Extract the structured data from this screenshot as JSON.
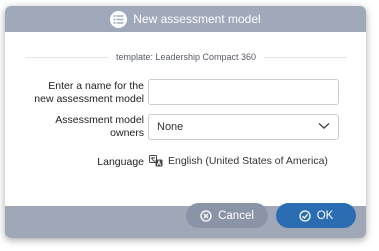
{
  "dialog": {
    "title": "New assessment model",
    "template_text": "template: Leadership Compact 360"
  },
  "form": {
    "name_label_line1": "Enter a name for the",
    "name_label_line2": "new assessment model",
    "name_value": "",
    "owners_label_line1": "Assessment model",
    "owners_label_line2": "owners",
    "owners_value": "None",
    "language_label": "Language",
    "language_value": "English (United States of America)"
  },
  "buttons": {
    "cancel": "Cancel",
    "ok": "OK"
  },
  "icons": {
    "title": "list-icon",
    "language": "translate-icon",
    "dropdown": "chevron-down-icon",
    "cancel": "cancel-circle-icon",
    "ok": "check-circle-icon"
  },
  "colors": {
    "titlebar": "#9fa9ba",
    "footer": "#a0a8b8",
    "cancel_button": "#8a94a6",
    "ok_button": "#2b6db2"
  }
}
